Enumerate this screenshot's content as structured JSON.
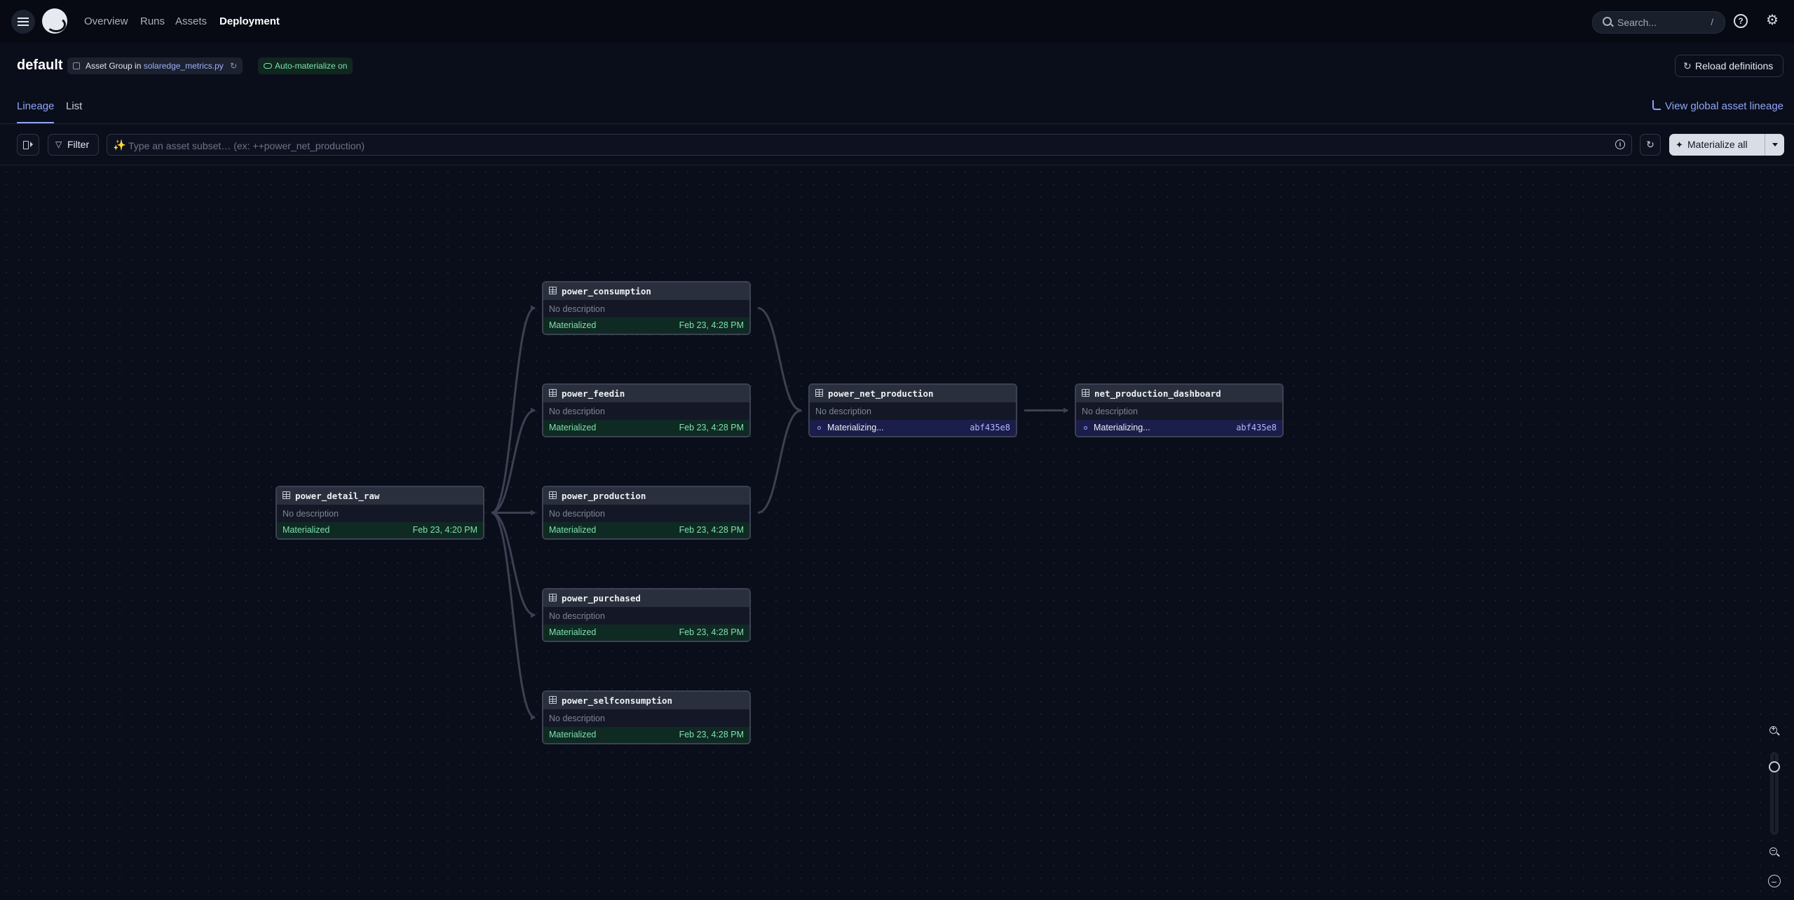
{
  "nav": {
    "links": [
      "Overview",
      "Runs",
      "Assets",
      "Deployment"
    ],
    "active": "Deployment",
    "search_placeholder": "Search...",
    "search_shortcut": "/"
  },
  "header": {
    "title": "default",
    "group_tag_prefix": "Asset Group in",
    "group_tag_location": "solaredge_metrics.py",
    "auto_materialize_tag": "Auto-materialize on",
    "reload_button": "Reload definitions"
  },
  "tabs": {
    "lineage": "Lineage",
    "list": "List",
    "active": "Lineage",
    "global_lineage_link": "View global asset lineage"
  },
  "toolbar": {
    "filter_label": "Filter",
    "query_placeholder": "Type an asset subset… (ex: ++power_net_production)",
    "materialize_all_label": "Materialize all"
  },
  "graph": {
    "nodes": {
      "power_detail_raw": {
        "name": "power_detail_raw",
        "description": "No description",
        "status": "Materialized",
        "timestamp": "Feb 23, 4:20 PM"
      },
      "power_consumption": {
        "name": "power_consumption",
        "description": "No description",
        "status": "Materialized",
        "timestamp": "Feb 23, 4:28 PM"
      },
      "power_feedin": {
        "name": "power_feedin",
        "description": "No description",
        "status": "Materialized",
        "timestamp": "Feb 23, 4:28 PM"
      },
      "power_production": {
        "name": "power_production",
        "description": "No description",
        "status": "Materialized",
        "timestamp": "Feb 23, 4:28 PM"
      },
      "power_purchased": {
        "name": "power_purchased",
        "description": "No description",
        "status": "Materialized",
        "timestamp": "Feb 23, 4:28 PM"
      },
      "power_selfconsumption": {
        "name": "power_selfconsumption",
        "description": "No description",
        "status": "Materialized",
        "timestamp": "Feb 23, 4:28 PM"
      },
      "power_net_production": {
        "name": "power_net_production",
        "description": "No description",
        "status": "Materializing...",
        "run_id": "abf435e8"
      },
      "net_production_dashboard": {
        "name": "net_production_dashboard",
        "description": "No description",
        "status": "Materializing...",
        "run_id": "abf435e8"
      }
    },
    "edges": [
      [
        "power_detail_raw",
        "power_consumption"
      ],
      [
        "power_detail_raw",
        "power_feedin"
      ],
      [
        "power_detail_raw",
        "power_production"
      ],
      [
        "power_detail_raw",
        "power_purchased"
      ],
      [
        "power_detail_raw",
        "power_selfconsumption"
      ],
      [
        "power_consumption",
        "power_net_production"
      ],
      [
        "power_production",
        "power_net_production"
      ],
      [
        "power_net_production",
        "net_production_dashboard"
      ]
    ]
  },
  "colors": {
    "background": "#0a0e1a",
    "accent": "#8fa3f5",
    "materialized": "#7fe0b0",
    "materializing_bg": "#1b1d4a"
  }
}
